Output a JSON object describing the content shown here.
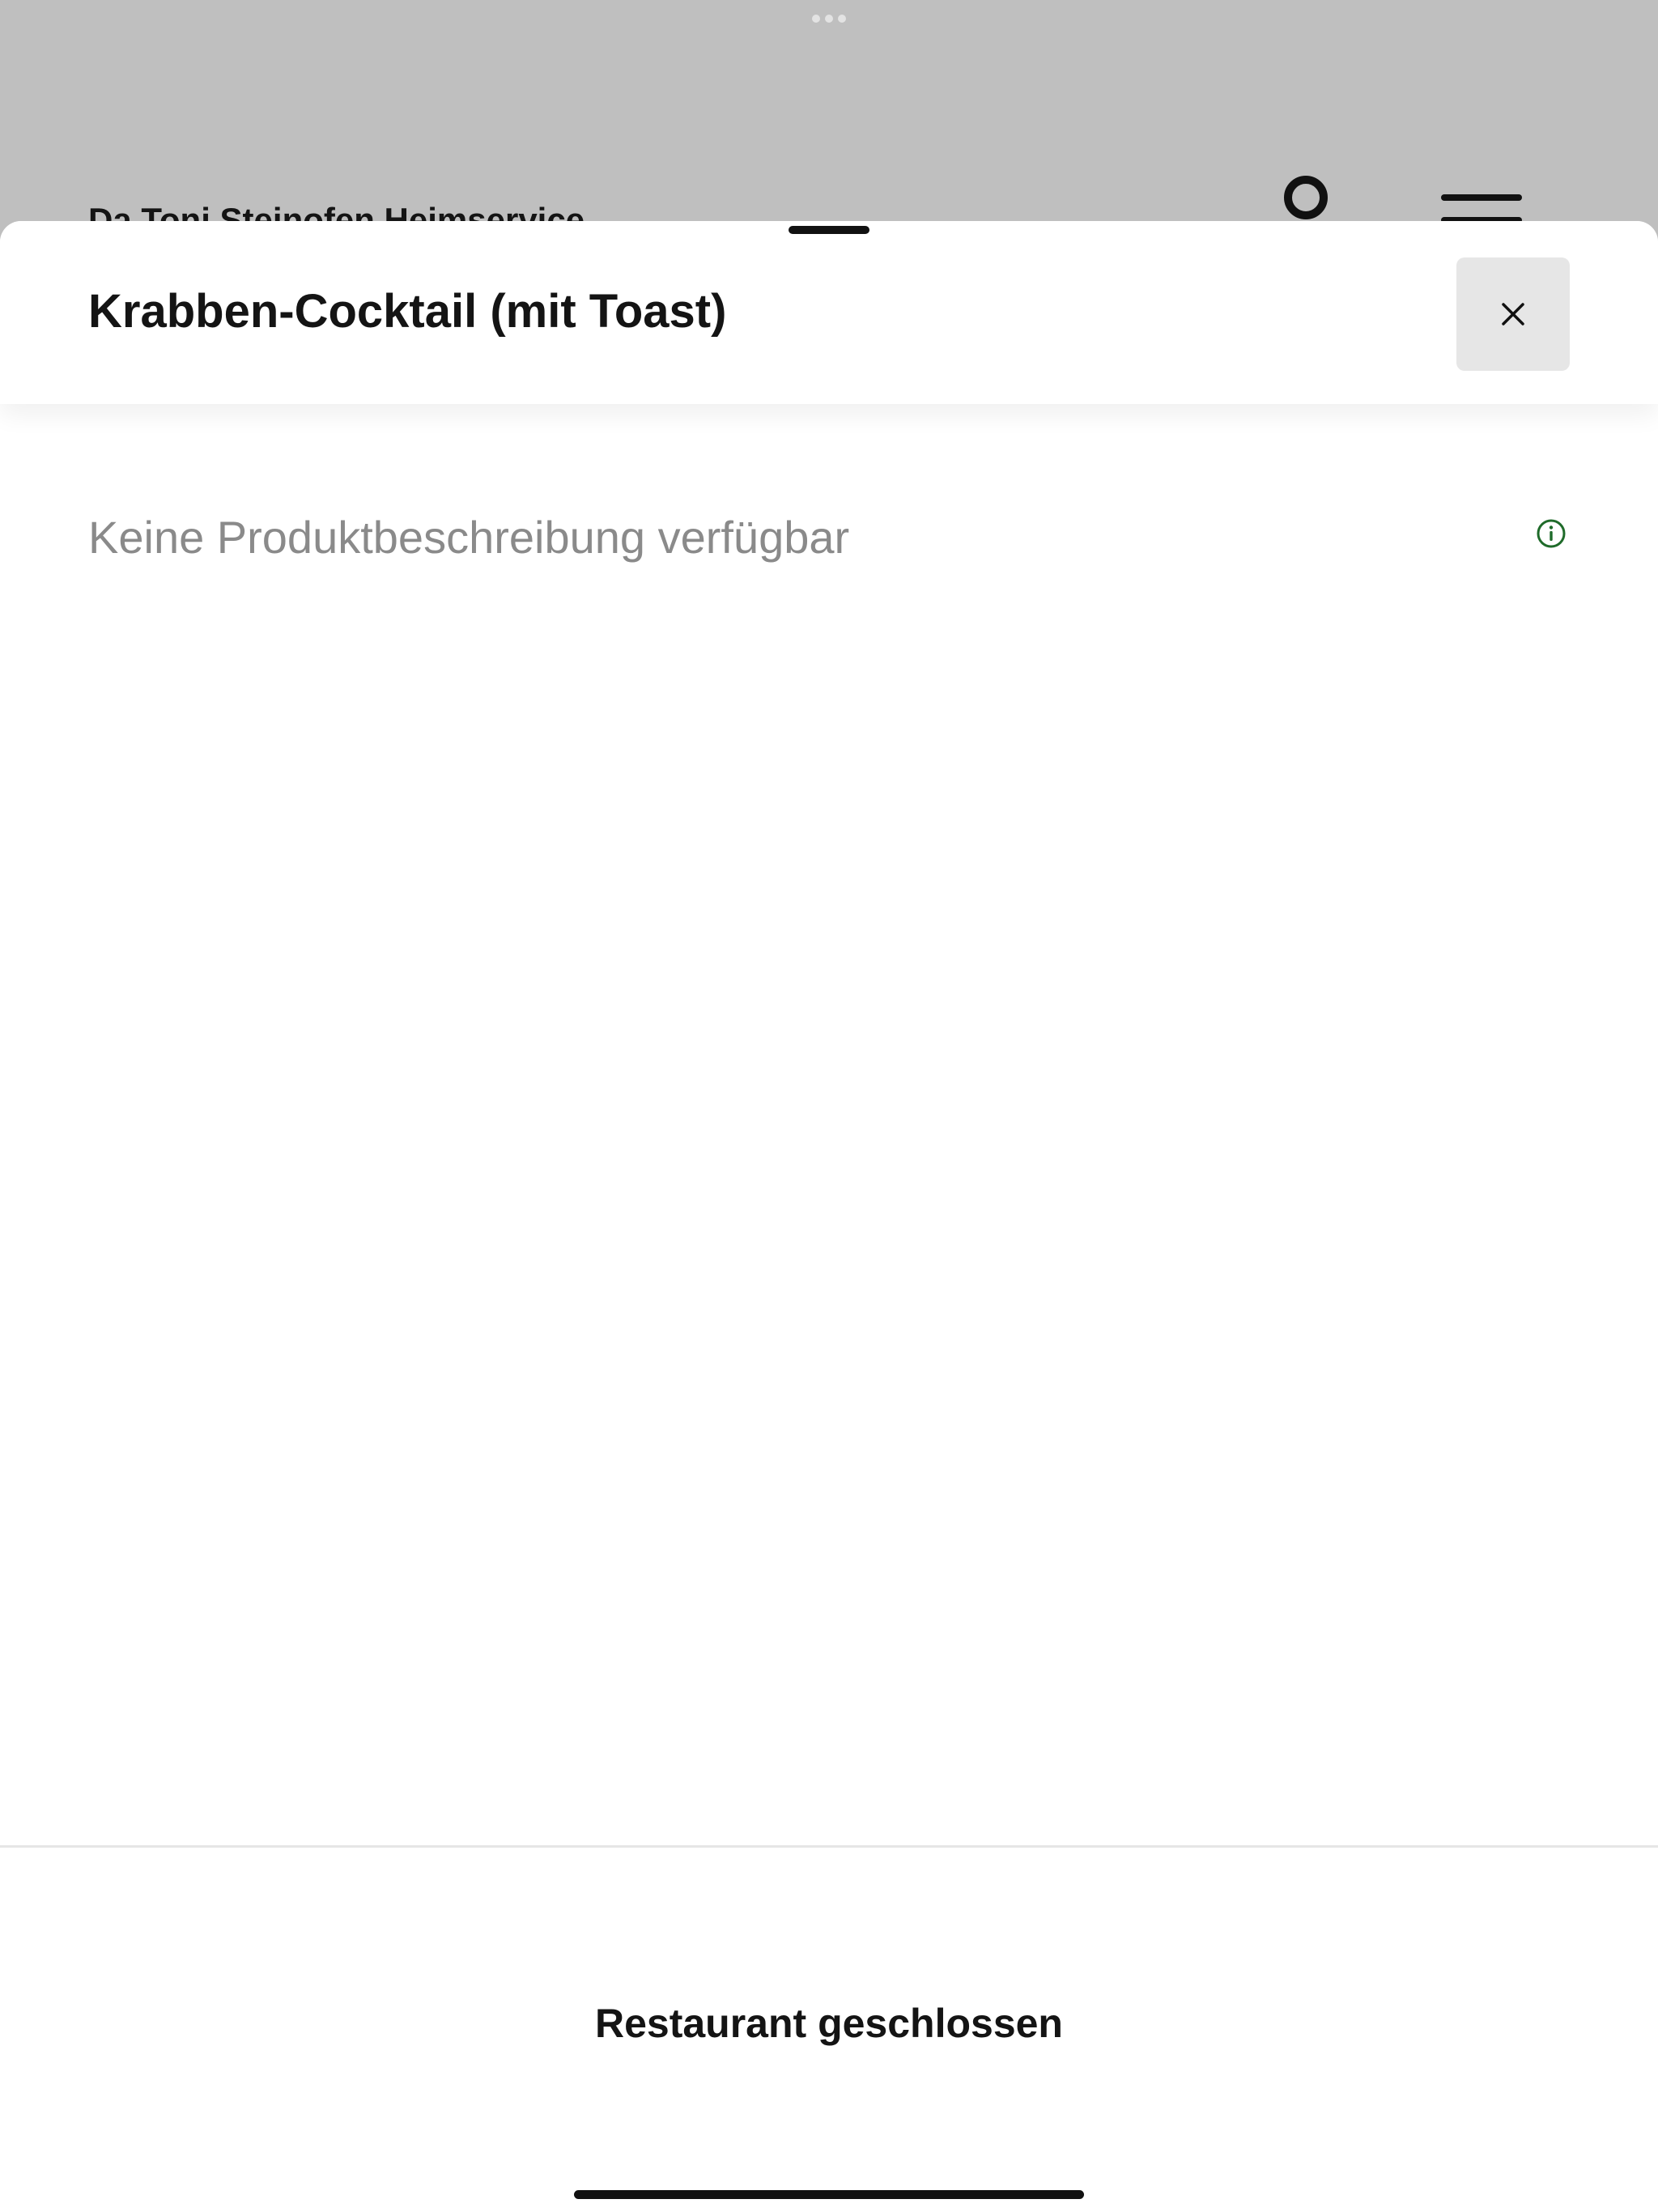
{
  "background_page": {
    "restaurant_name": "Da Toni Steinofen Heimservice",
    "search_icon": "search-icon",
    "menu_icon": "hamburger-menu-icon"
  },
  "product_sheet": {
    "title": "Krabben-Cocktail (mit Toast)",
    "close_icon": "close-icon",
    "description": "Keine Produktbeschreibung verfügbar",
    "info_icon": "info-icon",
    "footer_status": "Restaurant geschlossen"
  },
  "colors": {
    "backdrop": "#bfbfbf",
    "sheet": "#ffffff",
    "close_button_bg": "#e6e6e6",
    "description_text": "#8a8a8a",
    "info_icon": "#1f6b2a",
    "text_primary": "#141414"
  }
}
